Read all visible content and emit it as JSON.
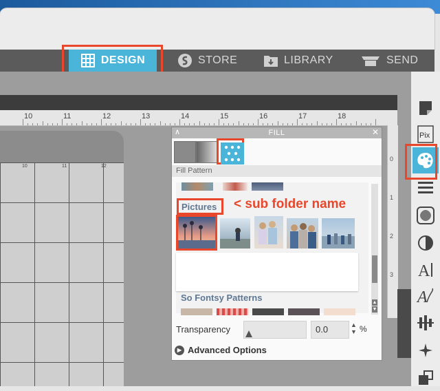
{
  "nav": {
    "tabs": [
      {
        "label": "DESIGN",
        "icon": "grid-icon"
      },
      {
        "label": "STORE",
        "icon": "silhouette-s-icon"
      },
      {
        "label": "LIBRARY",
        "icon": "library-download-icon"
      },
      {
        "label": "SEND",
        "icon": "cutter-icon"
      }
    ]
  },
  "ruler": {
    "numbers": [
      "10",
      "11",
      "12",
      "13",
      "14",
      "15",
      "16",
      "17",
      "18"
    ]
  },
  "vruler": {
    "numbers": [
      "0",
      "1",
      "2",
      "3"
    ]
  },
  "mat": {
    "grid_numbers": [
      "10",
      "11",
      "12"
    ]
  },
  "fill_panel": {
    "title": "FILL",
    "section_label": "Fill Pattern",
    "pictures_label": "Pictures",
    "so_fontsy_label": "So Fontsy Patterns",
    "transparency_label": "Transparency",
    "transparency_value": "0.0",
    "transparency_unit": "%",
    "advanced_options_label": "Advanced Options"
  },
  "annotation": {
    "text": "< sub folder name"
  },
  "colors": {
    "accent": "#4ab4d9",
    "highlight": "#e8472b",
    "folder_label": "#5e7894"
  },
  "sidebar": {
    "icons": [
      "page-setup-icon",
      "pixscan-icon",
      "fill-palette-icon",
      "line-style-icon",
      "offset-icon",
      "trace-icon",
      "text-icon",
      "text-style-icon",
      "align-icon",
      "replicate-icon",
      "transform-icon"
    ]
  }
}
